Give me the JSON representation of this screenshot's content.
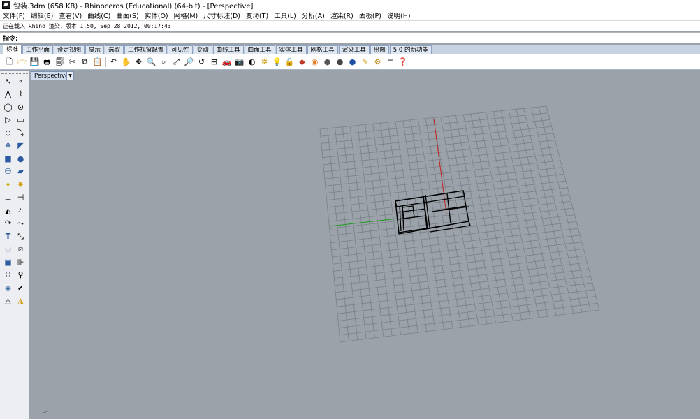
{
  "window": {
    "title": "包装.3dm (658 KB) - Rhinoceros (Educational) (64-bit) - [Perspective]"
  },
  "menu": [
    "文件(F)",
    "编辑(E)",
    "查看(V)",
    "曲线(C)",
    "曲面(S)",
    "实体(O)",
    "网格(M)",
    "尺寸标注(D)",
    "变动(T)",
    "工具(L)",
    "分析(A)",
    "渲染(R)",
    "面板(P)",
    "说明(H)"
  ],
  "command": {
    "history": "正在载入 Rhino 渲染，版本 1.50, Sep 28 2012, 00:17:43",
    "prompt": "指令:",
    "value": ""
  },
  "tabs": [
    "标准",
    "工作平面",
    "设定视图",
    "显示",
    "选取",
    "工作视窗配置",
    "可见性",
    "变动",
    "曲线工具",
    "曲面工具",
    "实体工具",
    "网格工具",
    "渲染工具",
    "出图",
    "5.0 的新功能"
  ],
  "active_tab": "标准",
  "toolbar_icons": [
    "new-icon",
    "open-icon",
    "save-icon",
    "print-icon",
    "import-icon",
    "cut-icon",
    "copy-icon",
    "paste-icon",
    "undo-icon",
    "pan-icon",
    "rotate-view-icon",
    "zoom-icon",
    "zoom-window-icon",
    "zoom-extents-icon",
    "zoom-selected-icon",
    "undo-view-icon",
    "four-viewports-icon",
    "car-icon",
    "camera-icon",
    "display-mode-icon",
    "snap-icon",
    "light-icon",
    "lock-icon",
    "material-icon",
    "color-wheel-icon",
    "shaded-sphere-icon",
    "render-sphere-icon",
    "blue-sphere-icon",
    "options-icon",
    "gear-icon",
    "command-history-icon",
    "help-icon"
  ],
  "sidebar_icons": [
    "select-icon",
    "point-icon",
    "polyline-icon",
    "curve-icon",
    "circle-icon",
    "arc-icon",
    "ellipse-icon",
    "rectangle-icon",
    "polygon-icon",
    "fillet-icon",
    "freeform-icon",
    "surface-icon",
    "box-icon",
    "sphere-icon",
    "cylinder-icon",
    "extrude-icon",
    "transform-icon",
    "explode-icon",
    "trim-icon",
    "split-icon",
    "boolean-icon",
    "group-icon",
    "offset-icon",
    "curve-edit-icon",
    "text-icon",
    "dimension-icon",
    "array-icon",
    "mirror-icon",
    "layer-icon",
    "properties-icon",
    "grid-icon",
    "checkmark-icon",
    "analysis-icon",
    "tools-icon",
    "render-icon",
    "paint-icon"
  ],
  "viewport": {
    "name": "Perspective"
  }
}
